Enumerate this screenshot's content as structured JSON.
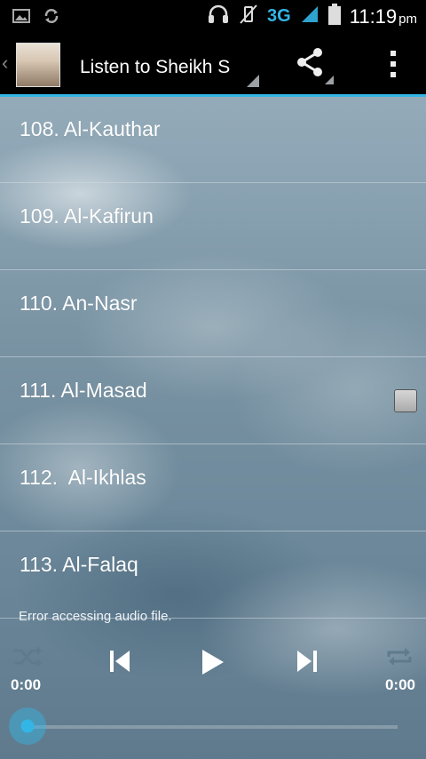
{
  "status_bar": {
    "network": "3G",
    "time": "11:19",
    "ampm": "pm"
  },
  "action_bar": {
    "title": "Listen to Sheikh S"
  },
  "surahs": [
    {
      "label": "108. Al-Kauthar"
    },
    {
      "label": "109. Al-Kafirun"
    },
    {
      "label": "110. An-Nasr"
    },
    {
      "label": "111. Al-Masad"
    },
    {
      "label": "112.  Al-Ikhlas"
    },
    {
      "label": "113. Al-Falaq"
    }
  ],
  "player": {
    "message": "Error accessing audio file.",
    "elapsed": "0:00",
    "duration": "0:00",
    "progress": 0
  },
  "colors": {
    "accent": "#33b5e5",
    "action_bar_bg": "#000000"
  }
}
